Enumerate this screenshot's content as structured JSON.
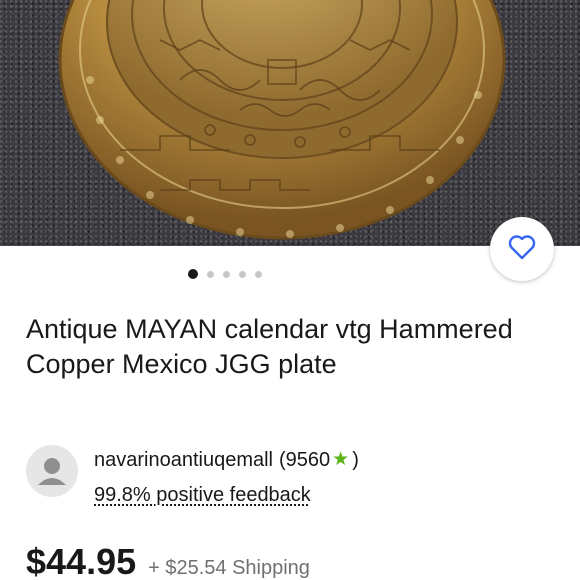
{
  "listing": {
    "title": "Antique MAYAN calendar vtg Hammered Copper Mexico JGG plate",
    "image_count": 5,
    "active_image_index": 0,
    "favorite_icon": "heart-outline-icon"
  },
  "seller": {
    "name": "navarinoantiuqemall",
    "feedback_score_text": "(9560",
    "feedback_score_close": ")",
    "star_icon": "star-icon",
    "star_color": "#5cb31a",
    "positive_feedback": "99.8% positive feedback"
  },
  "pricing": {
    "price": "$44.95",
    "shipping": "+ $25.54 Shipping"
  },
  "colors": {
    "accent": "#3665f3",
    "text": "#191919",
    "muted": "#707070"
  }
}
